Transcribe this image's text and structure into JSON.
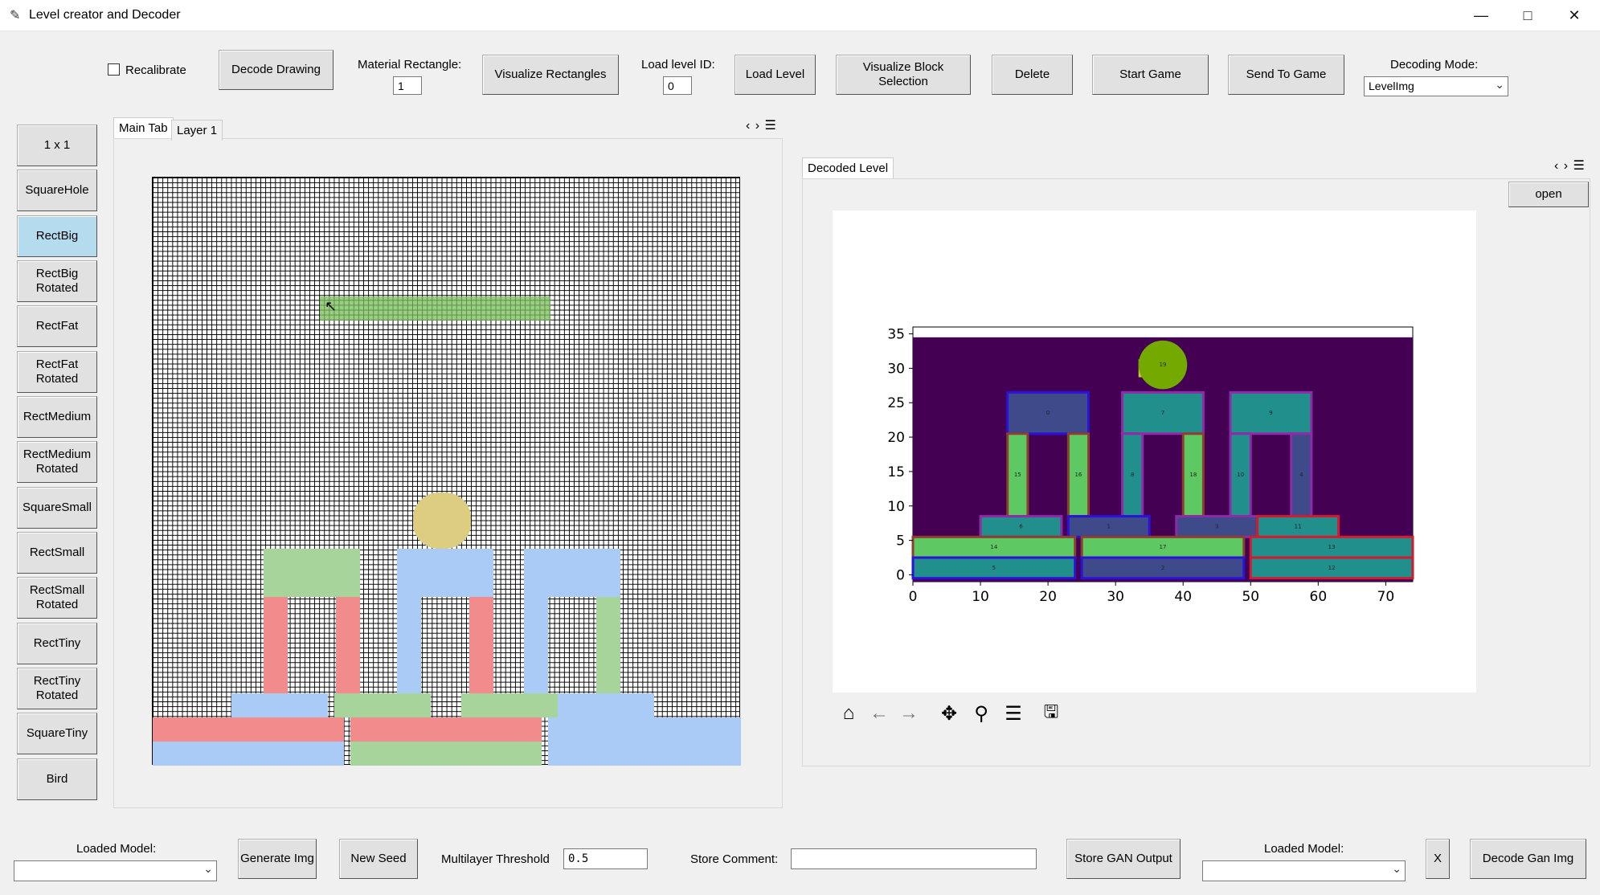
{
  "window": {
    "title": "Level creator and Decoder",
    "minimize_icon": "minimize-icon",
    "maximize_icon": "maximize-icon",
    "close_icon": "close-icon"
  },
  "toolbar": {
    "recalibrate_label": "Recalibrate",
    "decode_drawing": "Decode Drawing",
    "material_rect_label": "Material Rectangle:",
    "material_rect_value": "1",
    "visualize_rects": "Visualize Rectangles",
    "load_level_id_label": "Load level ID:",
    "load_level_id_value": "0",
    "load_level": "Load Level",
    "visualize_block_selection": "Visualize Block Selection",
    "delete": "Delete",
    "start_game": "Start Game",
    "send_to_game": "Send To Game",
    "decoding_mode_label": "Decoding Mode:",
    "decoding_mode_value": "LevelImg"
  },
  "sidebar": {
    "items": [
      {
        "label": "1 x 1"
      },
      {
        "label": "SquareHole"
      },
      {
        "label": "RectBig"
      },
      {
        "label": "RectBig Rotated"
      },
      {
        "label": "RectFat"
      },
      {
        "label": "RectFat Rotated"
      },
      {
        "label": "RectMedium"
      },
      {
        "label": "RectMedium Rotated"
      },
      {
        "label": "SquareSmall"
      },
      {
        "label": "RectSmall"
      },
      {
        "label": "RectSmall Rotated"
      },
      {
        "label": "RectTiny"
      },
      {
        "label": "RectTiny Rotated"
      },
      {
        "label": "SquareTiny"
      },
      {
        "label": "Bird"
      }
    ],
    "active": "RectBig"
  },
  "left_tabs": {
    "main": "Main Tab",
    "layer1": "Layer 1"
  },
  "right_tabs": {
    "decoded": "Decoded Level",
    "open": "open"
  },
  "colors": {
    "pink": "#f28b8b",
    "blue": "#a9cbf5",
    "green": "#a7d49a",
    "bird": "#dccd80",
    "plot_bg": "#440154"
  },
  "chart_data": {
    "type": "heatmap",
    "x_ticks": [
      "0",
      "10",
      "20",
      "30",
      "40",
      "50",
      "60",
      "70"
    ],
    "y_ticks": [
      "0",
      "5",
      "10",
      "15",
      "20",
      "25",
      "30",
      "35"
    ],
    "xlim": [
      0,
      74
    ],
    "ylim": [
      -1,
      36
    ],
    "blocks": [
      {
        "id": "0",
        "x0": 14,
        "x1": 26,
        "y0": 20.5,
        "y1": 26.5,
        "fill": "#3e4a89",
        "edge": "#2a12d8"
      },
      {
        "id": "7",
        "x0": 31,
        "x1": 43,
        "y0": 20.5,
        "y1": 26.5,
        "fill": "#21908d",
        "edge": "#8e2ba8"
      },
      {
        "id": "9",
        "x0": 47,
        "x1": 59,
        "y0": 20.5,
        "y1": 26.5,
        "fill": "#21908d",
        "edge": "#8e2ba8"
      },
      {
        "id": "15",
        "x0": 14,
        "x1": 17,
        "y0": 8.5,
        "y1": 20.5,
        "fill": "#5ec962",
        "edge": "#8e3e2c"
      },
      {
        "id": "16",
        "x0": 23,
        "x1": 26,
        "y0": 8.5,
        "y1": 20.5,
        "fill": "#5ec962",
        "edge": "#8e3e2c"
      },
      {
        "id": "8",
        "x0": 31,
        "x1": 34,
        "y0": 8.5,
        "y1": 20.5,
        "fill": "#21908d",
        "edge": "#8e2ba8"
      },
      {
        "id": "18",
        "x0": 40,
        "x1": 43,
        "y0": 8.5,
        "y1": 20.5,
        "fill": "#5ec962",
        "edge": "#8e3e2c"
      },
      {
        "id": "10",
        "x0": 47,
        "x1": 50,
        "y0": 8.5,
        "y1": 20.5,
        "fill": "#21908d",
        "edge": "#8e2ba8"
      },
      {
        "id": "4",
        "x0": 56,
        "x1": 59,
        "y0": 8.5,
        "y1": 20.5,
        "fill": "#3e4a89",
        "edge": "#8e2ba8"
      },
      {
        "id": "6",
        "x0": 10,
        "x1": 22,
        "y0": 5.5,
        "y1": 8.5,
        "fill": "#21908d",
        "edge": "#8e2ba8"
      },
      {
        "id": "1",
        "x0": 23,
        "x1": 35,
        "y0": 5.5,
        "y1": 8.5,
        "fill": "#3e4a89",
        "edge": "#2a12d8"
      },
      {
        "id": "3",
        "x0": 39,
        "x1": 51,
        "y0": 5.5,
        "y1": 8.5,
        "fill": "#3e4a89",
        "edge": "#8e2ba8"
      },
      {
        "id": "11",
        "x0": 51,
        "x1": 63,
        "y0": 5.5,
        "y1": 8.5,
        "fill": "#21908d",
        "edge": "#d01c30"
      },
      {
        "id": "14",
        "x0": 0,
        "x1": 24,
        "y0": 2.5,
        "y1": 5.5,
        "fill": "#5ec962",
        "edge": "#8e3e2c"
      },
      {
        "id": "17",
        "x0": 25,
        "x1": 49,
        "y0": 2.5,
        "y1": 5.5,
        "fill": "#5ec962",
        "edge": "#8e3e2c"
      },
      {
        "id": "13",
        "x0": 50,
        "x1": 74,
        "y0": 2.5,
        "y1": 5.5,
        "fill": "#21908d",
        "edge": "#d01c30"
      },
      {
        "id": "5",
        "x0": 0,
        "x1": 24,
        "y0": -0.5,
        "y1": 2.5,
        "fill": "#21908d",
        "edge": "#2a12d8"
      },
      {
        "id": "2",
        "x0": 25,
        "x1": 49,
        "y0": -0.5,
        "y1": 2.5,
        "fill": "#3e4a89",
        "edge": "#2a12d8"
      },
      {
        "id": "12",
        "x0": 50,
        "x1": 74,
        "y0": -0.5,
        "y1": 2.5,
        "fill": "#21908d",
        "edge": "#d01c30"
      }
    ],
    "bird": {
      "id": "19",
      "cx": 37,
      "cy": 30.5,
      "r": 3.6,
      "fill": "#74a900"
    },
    "background": {
      "y0": -1,
      "y1": 34.5
    }
  },
  "plot_toolbar": {
    "icons": [
      "home-icon",
      "back-icon",
      "forward-icon",
      "pan-icon",
      "zoom-icon",
      "configure-icon",
      "save-icon"
    ]
  },
  "bottom": {
    "loaded_model_label": "Loaded Model:",
    "loaded_model_value": "",
    "generate_img": "Generate Img",
    "new_seed": "New Seed",
    "multilayer_threshold_label": "Multilayer Threshold",
    "multilayer_threshold_value": "0.5",
    "store_comment_label": "Store Comment:",
    "store_comment_value": "",
    "store_gan_output": "Store GAN Output",
    "loaded_model2_label": "Loaded Model:",
    "loaded_model2_value": "",
    "x_button": "X",
    "decode_gan_img": "Decode Gan Img"
  }
}
